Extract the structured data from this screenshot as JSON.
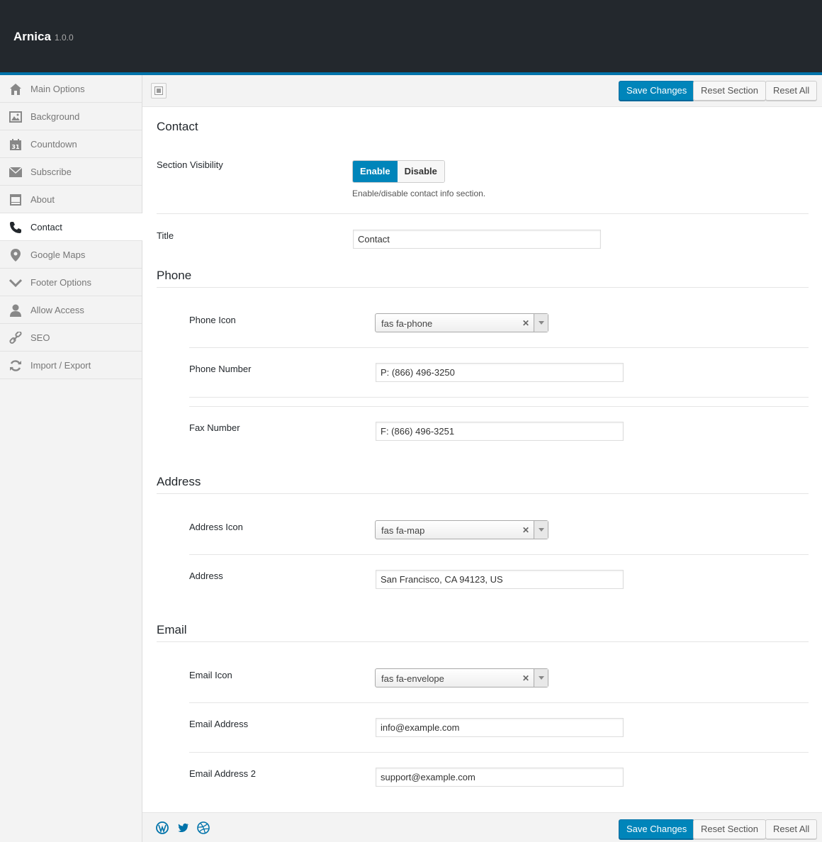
{
  "header": {
    "app_name": "Arnica",
    "version": "1.0.0"
  },
  "sidebar": {
    "items": [
      {
        "label": "Main Options",
        "icon": "home-icon"
      },
      {
        "label": "Background",
        "icon": "image-icon"
      },
      {
        "label": "Countdown",
        "icon": "calendar-icon"
      },
      {
        "label": "Subscribe",
        "icon": "envelope-icon"
      },
      {
        "label": "About",
        "icon": "window-icon"
      },
      {
        "label": "Contact",
        "icon": "phone-icon",
        "active": true
      },
      {
        "label": "Google Maps",
        "icon": "map-pin-icon"
      },
      {
        "label": "Footer Options",
        "icon": "chevron-down-icon"
      },
      {
        "label": "Allow Access",
        "icon": "user-icon"
      },
      {
        "label": "SEO",
        "icon": "link-icon"
      },
      {
        "label": "Import / Export",
        "icon": "refresh-icon"
      }
    ]
  },
  "toolbar": {
    "save_label": "Save Changes",
    "reset_section_label": "Reset Section",
    "reset_all_label": "Reset All"
  },
  "content": {
    "title": "Contact",
    "visibility": {
      "label": "Section Visibility",
      "enable_label": "Enable",
      "disable_label": "Disable",
      "selected": "Enable",
      "description": "Enable/disable contact info section."
    },
    "title_field": {
      "label": "Title",
      "value": "Contact"
    },
    "phone": {
      "heading": "Phone",
      "icon_label": "Phone Icon",
      "icon_value": "fas fa-phone",
      "number_label": "Phone Number",
      "number_value": "P: (866) 496-3250",
      "fax_label": "Fax Number",
      "fax_value": "F: (866) 496-3251"
    },
    "address": {
      "heading": "Address",
      "icon_label": "Address Icon",
      "icon_value": "fas fa-map",
      "address_label": "Address",
      "address_value": "San Francisco, CA 94123, US"
    },
    "email": {
      "heading": "Email",
      "icon_label": "Email Icon",
      "icon_value": "fas fa-envelope",
      "address_label": "Email Address",
      "address_value": "info@example.com",
      "address2_label": "Email Address 2",
      "address2_value": "support@example.com"
    }
  },
  "footer": {
    "social_icons": [
      "wordpress-icon",
      "twitter-icon",
      "dribbble-icon"
    ]
  },
  "colors": {
    "accent": "#0085ba",
    "topbar": "#23282d",
    "accent_border": "#0073aa"
  }
}
